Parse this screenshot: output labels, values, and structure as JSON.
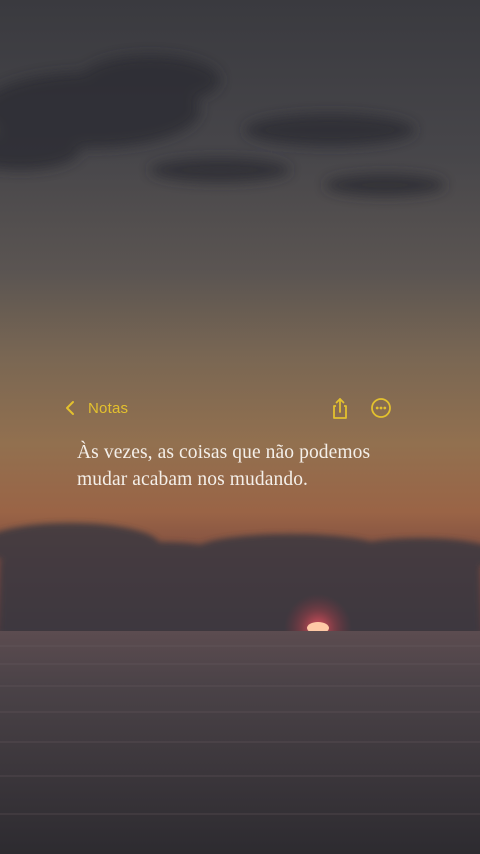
{
  "toolbar": {
    "back_label": "Notas",
    "back_icon": "chevron-left-icon",
    "share_icon": "share-icon",
    "more_icon": "ellipsis-circle-icon",
    "accent_color": "#e3c12e"
  },
  "note": {
    "lines": [
      "Às vezes, as coisas que não podemos",
      "mudar acabam nos mudando."
    ]
  }
}
